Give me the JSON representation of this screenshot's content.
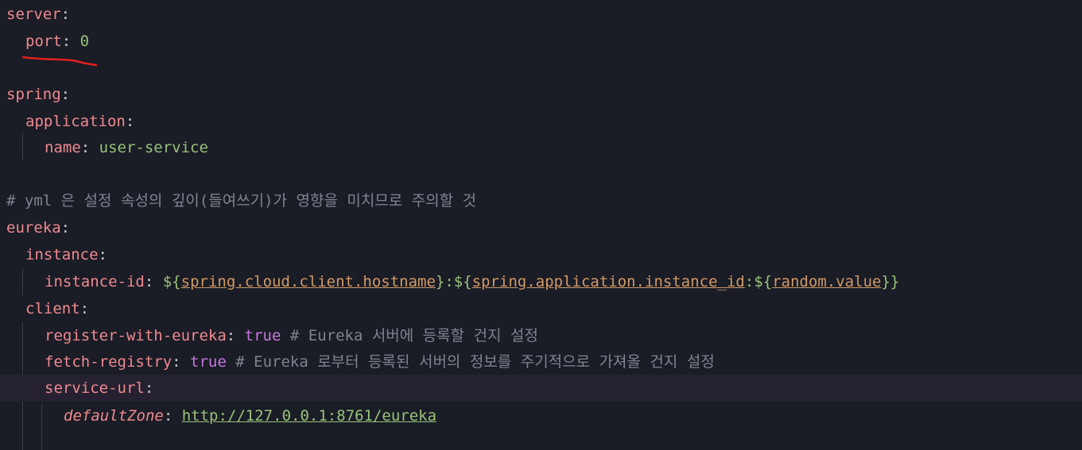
{
  "colors": {
    "background": "#1a1c26",
    "key": "#ef8a8f",
    "string": "#98c379",
    "boolean": "#c678dd",
    "comment": "#7f848e",
    "current_line": "#262130",
    "annotation": "#e02020"
  },
  "lines": [
    {
      "key": "server",
      "sep": ":"
    },
    {
      "key": "port",
      "sep": ": ",
      "value": "0"
    },
    {},
    {
      "key": "spring",
      "sep": ":"
    },
    {
      "key": "application",
      "sep": ":"
    },
    {
      "key": "name",
      "sep": ": ",
      "value": "user-service"
    },
    {},
    {
      "comment": "# yml 은 설정 속성의 깊이(들여쓰기)가 영향을 미치므로 주의할 것"
    },
    {
      "key": "eureka",
      "sep": ":"
    },
    {
      "key": "instance",
      "sep": ":"
    },
    {
      "key": "instance-id",
      "sep": ": ",
      "p1": "${",
      "ref1": "spring.cloud.client.hostname",
      "p2": "}:${",
      "ref2": "spring.application.instance_id",
      "p3": ":${",
      "ref3": "random.value",
      "p4": "}}"
    },
    {
      "key": "client",
      "sep": ":"
    },
    {
      "key": "register-with-eureka",
      "sep": ": ",
      "value": "true",
      "comment": " # Eureka 서버에 등록할 건지 설정"
    },
    {
      "key": "fetch-registry",
      "sep": ": ",
      "value": "true",
      "comment": " # Eureka 로부터 등록된 서버의 정보를 주기적으로 가져올 건지 설정"
    },
    {
      "key": "service-url",
      "sep": ":"
    },
    {
      "key": "defaultZone",
      "sep": ": ",
      "value": "http://127.0.0.1:8761/eureka"
    }
  ]
}
